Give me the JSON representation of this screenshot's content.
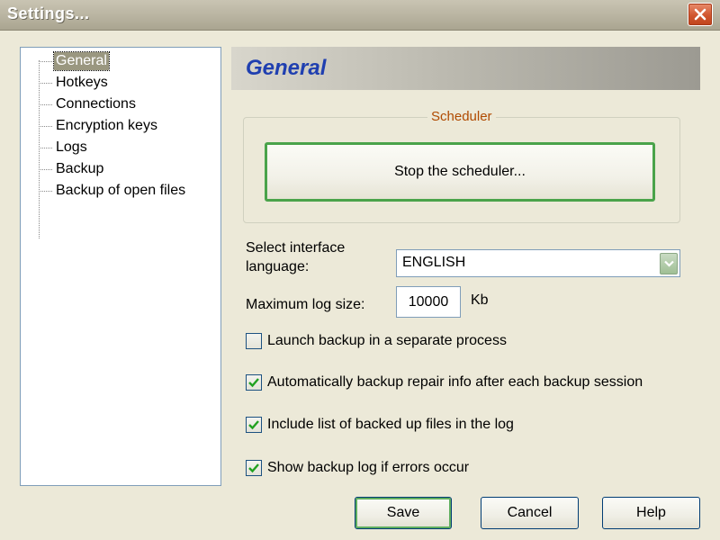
{
  "window": {
    "title": "Settings..."
  },
  "tree": {
    "items": [
      {
        "label": "General",
        "selected": true
      },
      {
        "label": "Hotkeys"
      },
      {
        "label": "Connections"
      },
      {
        "label": "Encryption keys"
      },
      {
        "label": "Logs"
      },
      {
        "label": "Backup"
      },
      {
        "label": "Backup of open files"
      }
    ]
  },
  "panel": {
    "title": "General",
    "scheduler": {
      "group_label": "Scheduler",
      "button_label": "Stop the scheduler..."
    },
    "language": {
      "label_line1": "Select interface",
      "label_line2": "language:",
      "value": "ENGLISH"
    },
    "log_size": {
      "label": "Maximum log size:",
      "value": "10000",
      "unit": "Kb"
    },
    "options": [
      {
        "label": "Launch backup in a separate process",
        "checked": false
      },
      {
        "label": "Automatically backup repair info after each backup session",
        "checked": true
      },
      {
        "label": "Include list of backed up files in the log",
        "checked": true
      },
      {
        "label": "Show backup log if errors occur",
        "checked": true
      }
    ]
  },
  "buttons": {
    "save": "Save",
    "cancel": "Cancel",
    "help": "Help"
  },
  "icons": {
    "close": "close-icon",
    "dropdown": "chevron-down-icon",
    "check": "check-icon"
  },
  "colors": {
    "accent": "#4aa34a",
    "header_title": "#1f3fb0",
    "group_label": "#b04a00",
    "close_button": "#d0562f"
  }
}
